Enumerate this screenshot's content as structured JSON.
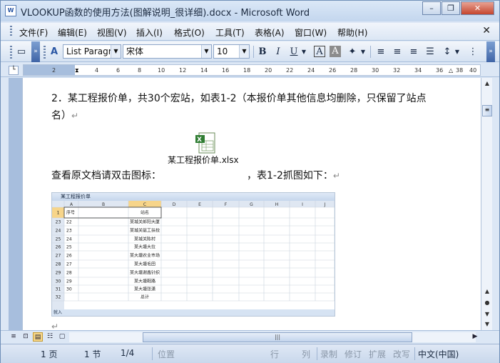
{
  "window": {
    "title": "VLOOKUP函数的使用方法(图解说明_很详细).docx - Microsoft Word",
    "minimize": "–",
    "restore": "❐",
    "close": "✕"
  },
  "menu": {
    "items": [
      "文件(F)",
      "编辑(E)",
      "视图(V)",
      "插入(I)",
      "格式(O)",
      "工具(T)",
      "表格(A)",
      "窗口(W)",
      "帮助(H)"
    ],
    "close": "✕"
  },
  "toolbar": {
    "style": "List Paragr",
    "font": "宋体",
    "size": "10",
    "bold": "B",
    "italic": "I",
    "underline": "U",
    "char_border": "A",
    "char_shading": "A",
    "highlight": "A"
  },
  "ruler": {
    "ticks": [
      "2",
      "2",
      "4",
      "6",
      "8",
      "10",
      "12",
      "14",
      "16",
      "18",
      "20",
      "22",
      "24",
      "26",
      "28",
      "30",
      "32",
      "34",
      "36",
      "38",
      "40"
    ]
  },
  "document": {
    "line1": "2．某工程报价单，共30个宏站，如表1-2（本报价单其他信息均删除，只保留了站点",
    "line2": "名）",
    "embed_file": "某工程报价单.xlsx",
    "line3_a": "查看原文档请双击图标：",
    "line3_b": "，表1-2抓图如下：",
    "para_mark": "↵"
  },
  "excel_shot": {
    "title": "某工程报价单",
    "columns": [
      "A",
      "B",
      "C",
      "D",
      "E",
      "F",
      "G",
      "H",
      "I",
      "J"
    ],
    "header_row": {
      "num": "1",
      "a": "序号",
      "b": "站名"
    },
    "rows": [
      {
        "num": "23",
        "a": "22",
        "b": "某城关郎阳大厦"
      },
      {
        "num": "24",
        "a": "23",
        "b": "某城关驱工扶校"
      },
      {
        "num": "25",
        "a": "24",
        "b": "某城关陈村"
      },
      {
        "num": "26",
        "a": "25",
        "b": "某大塘大拉"
      },
      {
        "num": "27",
        "a": "26",
        "b": "某大塘农业市场"
      },
      {
        "num": "28",
        "a": "27",
        "b": "某大塘毛田"
      },
      {
        "num": "29",
        "a": "28",
        "b": "某大塘谢鑫针织"
      },
      {
        "num": "30",
        "a": "29",
        "b": "某大塘鞋路"
      },
      {
        "num": "31",
        "a": "30",
        "b": "某大塘张潇"
      },
      {
        "num": "32",
        "a": "",
        "b": "总计"
      }
    ],
    "status": "就入"
  },
  "statusbar": {
    "page": "1 页",
    "section": "1 节",
    "pages": "1/4",
    "position": "位置",
    "line": "行",
    "col": "列",
    "rec": "录制",
    "trk": "修订",
    "ext": "扩展",
    "ovr": "改写",
    "lang": "中文(中国)"
  }
}
